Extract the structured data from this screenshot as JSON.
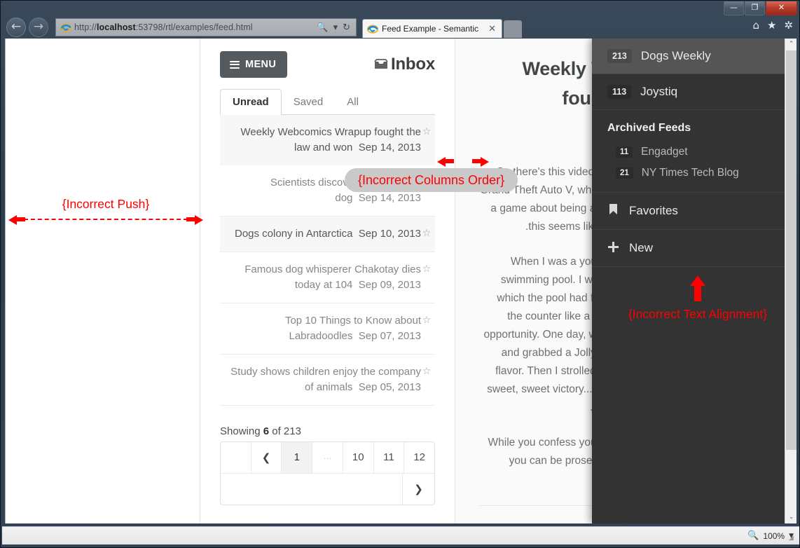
{
  "browser": {
    "window_buttons": {
      "minimize": "—",
      "maximize": "❐",
      "close": "✕"
    },
    "back_icon": "←",
    "forward_icon": "→",
    "url_prefix": "http://",
    "url_host": "localhost",
    "url_rest": ":53798/rtl/examples/feed.html",
    "url_full": "http://localhost:53798/rtl/examples/feed.html",
    "search_icon": "🔍",
    "dropdown_icon": "▾",
    "refresh_icon": "↻",
    "tab_title": "Feed Example - Semantic",
    "tab_close": "✕",
    "home_icon": "⌂",
    "favorites_icon": "★",
    "settings_icon": "✲",
    "zoom_level": "100%",
    "zoom_caret": "▼",
    "scroll_up": "⌃",
    "scroll_down": "⌄",
    "grip": "◢"
  },
  "feed_panel": {
    "menu_label": "MENU",
    "inbox_label": "Inbox",
    "inbox_icon": "✉",
    "tabs": [
      {
        "label": "Unread",
        "active": true
      },
      {
        "label": "Saved",
        "active": false
      },
      {
        "label": "All",
        "active": false
      }
    ],
    "star_icon": "☆",
    "items": [
      {
        "date": "Sep 14, 2013",
        "title": "Weekly Webcomics Wrapup fought the law and won",
        "shaded": true,
        "dark": true
      },
      {
        "date": "Sep 14, 2013",
        "title": "Scientists discover new breed of dog",
        "shaded": false,
        "dark": false
      },
      {
        "date": "Sep 10, 2013",
        "title": "Dogs colony in Antarctica",
        "shaded": true,
        "dark": true
      },
      {
        "date": "Sep 09, 2013",
        "title": "Famous dog whisperer Chakotay dies today at 104",
        "shaded": false,
        "dark": false
      },
      {
        "date": "Sep 07, 2013",
        "title": "Top 10 Things to Know about Labradoodles",
        "shaded": false,
        "dark": false
      },
      {
        "date": "Sep 05, 2013",
        "title": "Study shows children enjoy the company of animals",
        "shaded": false,
        "dark": false
      }
    ],
    "showing_prefix": "Showing ",
    "showing_count": "6",
    "showing_suffix": " of 213",
    "pagination": {
      "prev_icon": "❮",
      "next_icon": "❯",
      "pages": [
        "1",
        "…",
        "10",
        "11",
        "12"
      ],
      "active_page": "1"
    }
  },
  "article": {
    "title": "Weekly Webcomics Wrapup fought the law and won",
    "paragraphs": [
      "So there's this video game you may have heard of called Grand Theft Auto V, which came out this week. Anyways, it's a game about being a lovable roughneck ne'er-do-well, so this seems like the perfect time to talk about crime.",
      "When I was a young'un, my family belonged to a local swimming pool. I was deeply obsessed with their candy, which the pool had for sale. I would spend hours stalking the counter like a jungle cat, just waiting for the perfect opportunity. One day, while they were busy, I snuck through and grabbed a Jolly Rancher, both cherry and \"my own\" flavor. Then I strolled out to the sidewalk and savored my sweet, sweet victory... for all of ten minutes, before I had to sneak back in and put the thing back.",
      "While you confess your own youthful indiscretions, nothing you can be prosecuted for of course, please enjoy this week's webcomics."
    ]
  },
  "sidebar": {
    "items": [
      {
        "count": "213",
        "label": "Dogs Weekly",
        "active": true
      },
      {
        "count": "113",
        "label": "Joystiq",
        "active": false
      }
    ],
    "group": {
      "title": "Archived Feeds",
      "items": [
        {
          "count": "11",
          "label": "Engadget"
        },
        {
          "count": "21",
          "label": "NY Times Tech Blog"
        }
      ]
    },
    "favorites": {
      "icon": "🔖",
      "label": "Favorites"
    },
    "new": {
      "icon": "✚",
      "label": "New"
    }
  },
  "annotations": {
    "push": "{Incorrect Push}",
    "columns_order": "{Incorrect Columns Order}",
    "text_alignment": "{Incorrect Text Alignment}"
  },
  "colors": {
    "annotation_red": "#ff0000",
    "sidebar_bg": "#333333",
    "sidebar_active": "#555555",
    "menu_btn": "#555a5e"
  }
}
